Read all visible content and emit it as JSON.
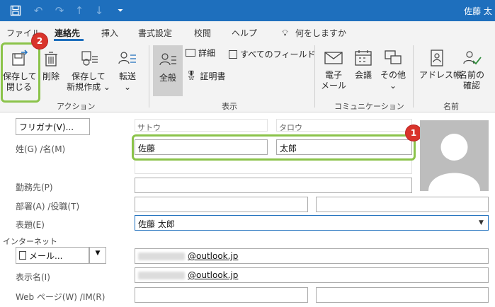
{
  "titlebar": {
    "user": "佐藤 太"
  },
  "menu": {
    "tabs": [
      "ファイル",
      "連絡先",
      "挿入",
      "書式設定",
      "校閲",
      "ヘルプ"
    ],
    "tell_me": "何をしますか"
  },
  "ribbon": {
    "action": {
      "save_close": [
        "保存して",
        "閉じる"
      ],
      "delete": "削除",
      "save_new": [
        "保存して",
        "新規作成 ⌄"
      ],
      "forward": [
        "転送",
        "⌄"
      ],
      "group": "アクション"
    },
    "show": {
      "general": "全般",
      "details": "詳細",
      "certificates": "証明書",
      "all_fields": "すべてのフィールド",
      "group": "表示"
    },
    "communicate": {
      "email": [
        "電子",
        "メール"
      ],
      "meeting": "会議",
      "other": [
        "その他",
        "⌄"
      ],
      "group": "コミュニケーション"
    },
    "names": {
      "address_book": "アドレス帳",
      "check_names": [
        "名前の",
        "確認"
      ],
      "group": "名前"
    }
  },
  "form": {
    "furigana_button": "フリガナ(V)...",
    "furigana_last": "サトウ",
    "furigana_first": "タロウ",
    "name_label": "姓(G)  /名(M)",
    "last_name": "佐藤",
    "first_name": "太郎",
    "company_label": "勤務先(P)",
    "dept_label": "部署(A)  /役職(T)",
    "fileas_label": "表題(E)",
    "fileas_value": "佐藤 太郎",
    "internet_label": "インターネット",
    "email_button": "メール...",
    "email_value": "@outlook.jp",
    "display_label": "表示名(I)",
    "display_value": "@outlook.jp",
    "web_label": "Web ページ(W)  /IM(R)"
  },
  "badges": [
    "1",
    "2"
  ]
}
